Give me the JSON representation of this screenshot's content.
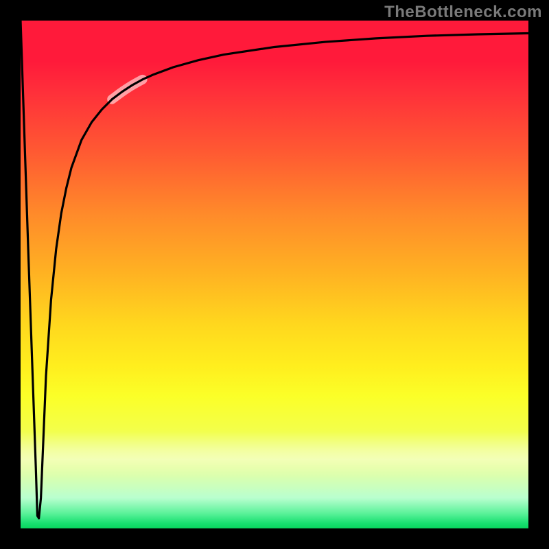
{
  "watermark": "TheBottleneck.com",
  "chart_data": {
    "type": "line",
    "title": "",
    "xlabel": "",
    "ylabel": "",
    "xlim": [
      0,
      100
    ],
    "ylim": [
      0,
      100
    ],
    "x": [
      0.0,
      1.5,
      3.0,
      3.3,
      3.6,
      4.0,
      4.5,
      5.0,
      6.0,
      7.0,
      8.0,
      9.0,
      10.0,
      12.0,
      14.0,
      16.0,
      18.0,
      20.0,
      22.0,
      24.0,
      26.0,
      30.0,
      35.0,
      40.0,
      50.0,
      60.0,
      70.0,
      80.0,
      90.0,
      100.0
    ],
    "y": [
      100.0,
      55.0,
      12.0,
      2.5,
      2.0,
      6.0,
      18.0,
      30.0,
      45.0,
      55.0,
      62.0,
      67.0,
      71.0,
      76.5,
      80.0,
      82.5,
      84.5,
      86.0,
      87.3,
      88.4,
      89.3,
      90.8,
      92.2,
      93.3,
      94.8,
      95.8,
      96.5,
      97.0,
      97.3,
      97.5
    ],
    "highlight_segment": {
      "x_from": 18.0,
      "x_to": 24.0
    },
    "background_gradient": {
      "top": "#ff1a3a",
      "mid": "#ffee1e",
      "bottom": "#08d45e"
    },
    "curve_color": "#000000"
  }
}
